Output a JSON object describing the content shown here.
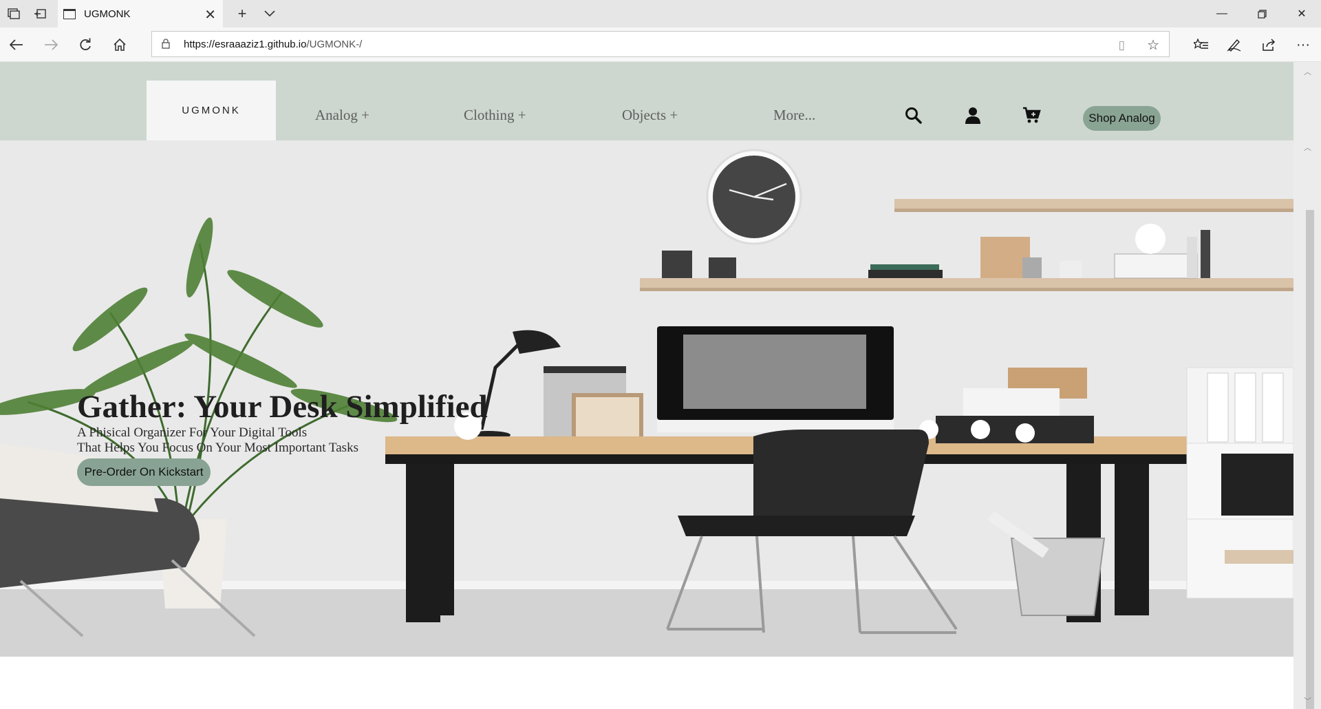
{
  "browser": {
    "tab_title": "UGMONK",
    "url_host": "https://esraaaziz1.github.io",
    "url_path": "/UGMONK-/"
  },
  "site": {
    "logo": "UGMONK",
    "menu": [
      {
        "label": "Analog +"
      },
      {
        "label": "Clothing +"
      },
      {
        "label": "Objects +"
      },
      {
        "label": "More..."
      }
    ],
    "shop_button": "Shop Analog"
  },
  "hero": {
    "title": "Gather: Your Desk Simplified",
    "subtitle_line1": "A Phisical Organizer For Your Digital Tools",
    "subtitle_line2": "That Helps You Focus On Your Most Important Tasks",
    "cta": "Pre-Order On Kickstart"
  },
  "colors": {
    "header_bg": "#cdd7cf",
    "accent_button": "#88a393"
  }
}
